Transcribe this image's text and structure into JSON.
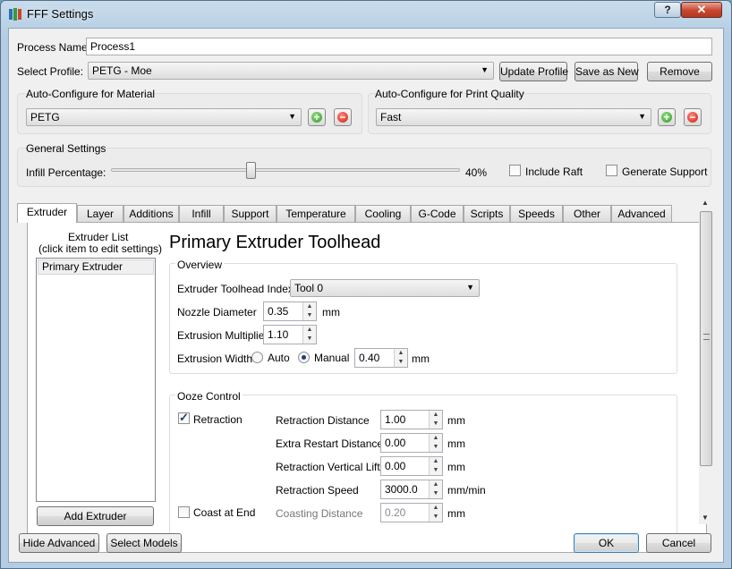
{
  "window": {
    "title": "FFF Settings",
    "help_label": "?",
    "close_label": "✕"
  },
  "process": {
    "label": "Process Name:",
    "value": "Process1"
  },
  "profile": {
    "label": "Select Profile:",
    "value": "PETG - Moe",
    "update_label": "Update Profile",
    "save_as_label": "Save as New",
    "remove_label": "Remove"
  },
  "material": {
    "title": "Auto-Configure for Material",
    "value": "PETG"
  },
  "quality": {
    "title": "Auto-Configure for Print Quality",
    "value": "Fast"
  },
  "general": {
    "title": "General Settings",
    "infill_label": "Infill Percentage:",
    "infill_value": "40%",
    "infill_fraction": 0.4,
    "raft_label": "Include Raft",
    "raft_checked": false,
    "support_label": "Generate Support",
    "support_checked": false
  },
  "tabs": [
    "Extruder",
    "Layer",
    "Additions",
    "Infill",
    "Support",
    "Temperature",
    "Cooling",
    "G-Code",
    "Scripts",
    "Speeds",
    "Other",
    "Advanced"
  ],
  "extruder_list": {
    "title_line1": "Extruder List",
    "title_line2": "(click item to edit settings)",
    "items": [
      "Primary Extruder"
    ],
    "add_label": "Add Extruder"
  },
  "toolhead": {
    "heading": "Primary Extruder Toolhead",
    "overview_title": "Overview",
    "index_label": "Extruder Toolhead Index",
    "index_value": "Tool 0",
    "nozzle_label": "Nozzle Diameter",
    "nozzle_value": "0.35",
    "nozzle_unit": "mm",
    "multiplier_label": "Extrusion Multiplier",
    "multiplier_value": "1.10",
    "width_label": "Extrusion Width",
    "auto_label": "Auto",
    "manual_label": "Manual",
    "width_value": "0.40",
    "width_unit": "mm"
  },
  "ooze": {
    "title": "Ooze Control",
    "retraction_label": "Retraction",
    "retraction_checked": true,
    "coast_label": "Coast at End",
    "coast_checked": false,
    "fields": [
      {
        "label": "Retraction Distance",
        "value": "1.00",
        "unit": "mm"
      },
      {
        "label": "Extra Restart Distance",
        "value": "0.00",
        "unit": "mm"
      },
      {
        "label": "Retraction Vertical Lift",
        "value": "0.00",
        "unit": "mm"
      },
      {
        "label": "Retraction Speed",
        "value": "3000.0",
        "unit": "mm/min"
      },
      {
        "label": "Coasting Distance",
        "value": "0.20",
        "unit": "mm"
      }
    ]
  },
  "footer": {
    "hide_label": "Hide Advanced",
    "select_label": "Select Models",
    "ok_label": "OK",
    "cancel_label": "Cancel"
  },
  "colors": {
    "title_bar": "#b4cde3",
    "close": "#c8452e",
    "add": "#2f9a25",
    "remove": "#d0180f"
  },
  "icons": {
    "app": "simplify3d-logo-icon",
    "add": "plus-circle-icon",
    "remove": "minus-circle-icon",
    "dropdown": "triangle-down-icon",
    "spin": "up-down-arrows-icon"
  }
}
